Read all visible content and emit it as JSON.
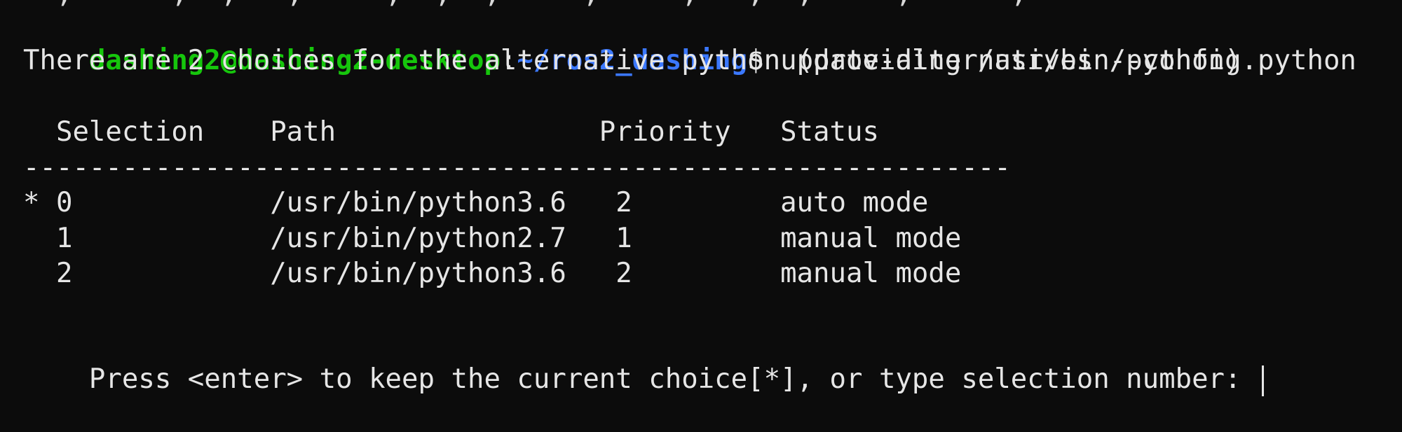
{
  "terminal": {
    "top_fragment": "  ,      ,  ,   ,     ,  ,  ,     ,     ,   ,  ,     ,      ,   ",
    "prompt": {
      "user_host": "dashing2@dashing2-desktop",
      "separator": ":",
      "path": "~/ros2_dashing",
      "dollar": "$",
      "command": " update-alternatives --config python"
    },
    "info_line": "There are 2 choices for the alternative python (providing /usr/bin/python).",
    "table": {
      "header": "  Selection    Path                Priority   Status",
      "divider": "------------------------------------------------------------",
      "rows": [
        "* 0            /usr/bin/python3.6   2         auto mode",
        "  1            /usr/bin/python2.7   1         manual mode",
        "  2            /usr/bin/python3.6   2         manual mode"
      ]
    },
    "input_prompt": "Press <enter> to keep the current choice[*], or type selection number: "
  }
}
